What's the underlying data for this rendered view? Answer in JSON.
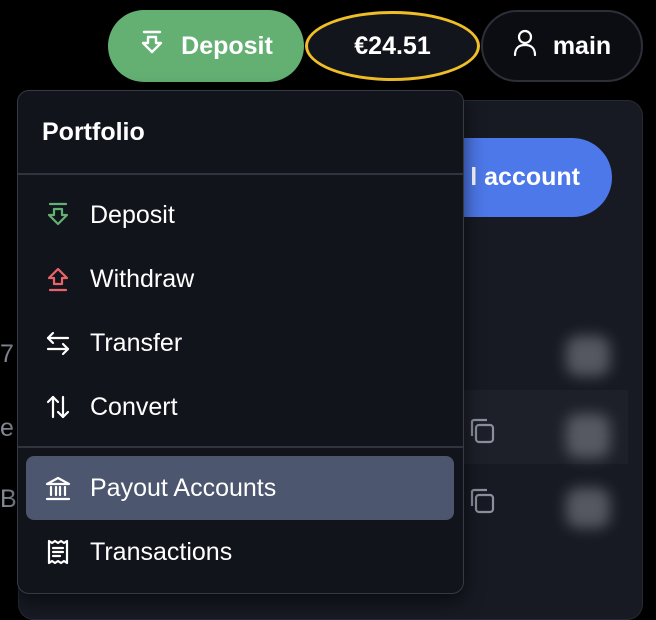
{
  "header": {
    "deposit_label": "Deposit",
    "balance": "€24.51",
    "account_label": "main"
  },
  "background": {
    "add_account_label": "l account",
    "row_chars": [
      "7",
      "e",
      "B"
    ]
  },
  "menu": {
    "title": "Portfolio",
    "items": [
      {
        "label": "Deposit",
        "icon": "deposit-icon"
      },
      {
        "label": "Withdraw",
        "icon": "withdraw-icon"
      },
      {
        "label": "Transfer",
        "icon": "transfer-icon"
      },
      {
        "label": "Convert",
        "icon": "convert-icon"
      },
      {
        "label": "Payout Accounts",
        "icon": "bank-icon",
        "active": true
      },
      {
        "label": "Transactions",
        "icon": "receipt-icon"
      }
    ]
  },
  "colors": {
    "deposit_green": "#64b073",
    "balance_highlight": "#f0be27",
    "accent_blue": "#4d78e9",
    "withdraw_red": "#e8636a",
    "active_item": "#4c566e"
  }
}
